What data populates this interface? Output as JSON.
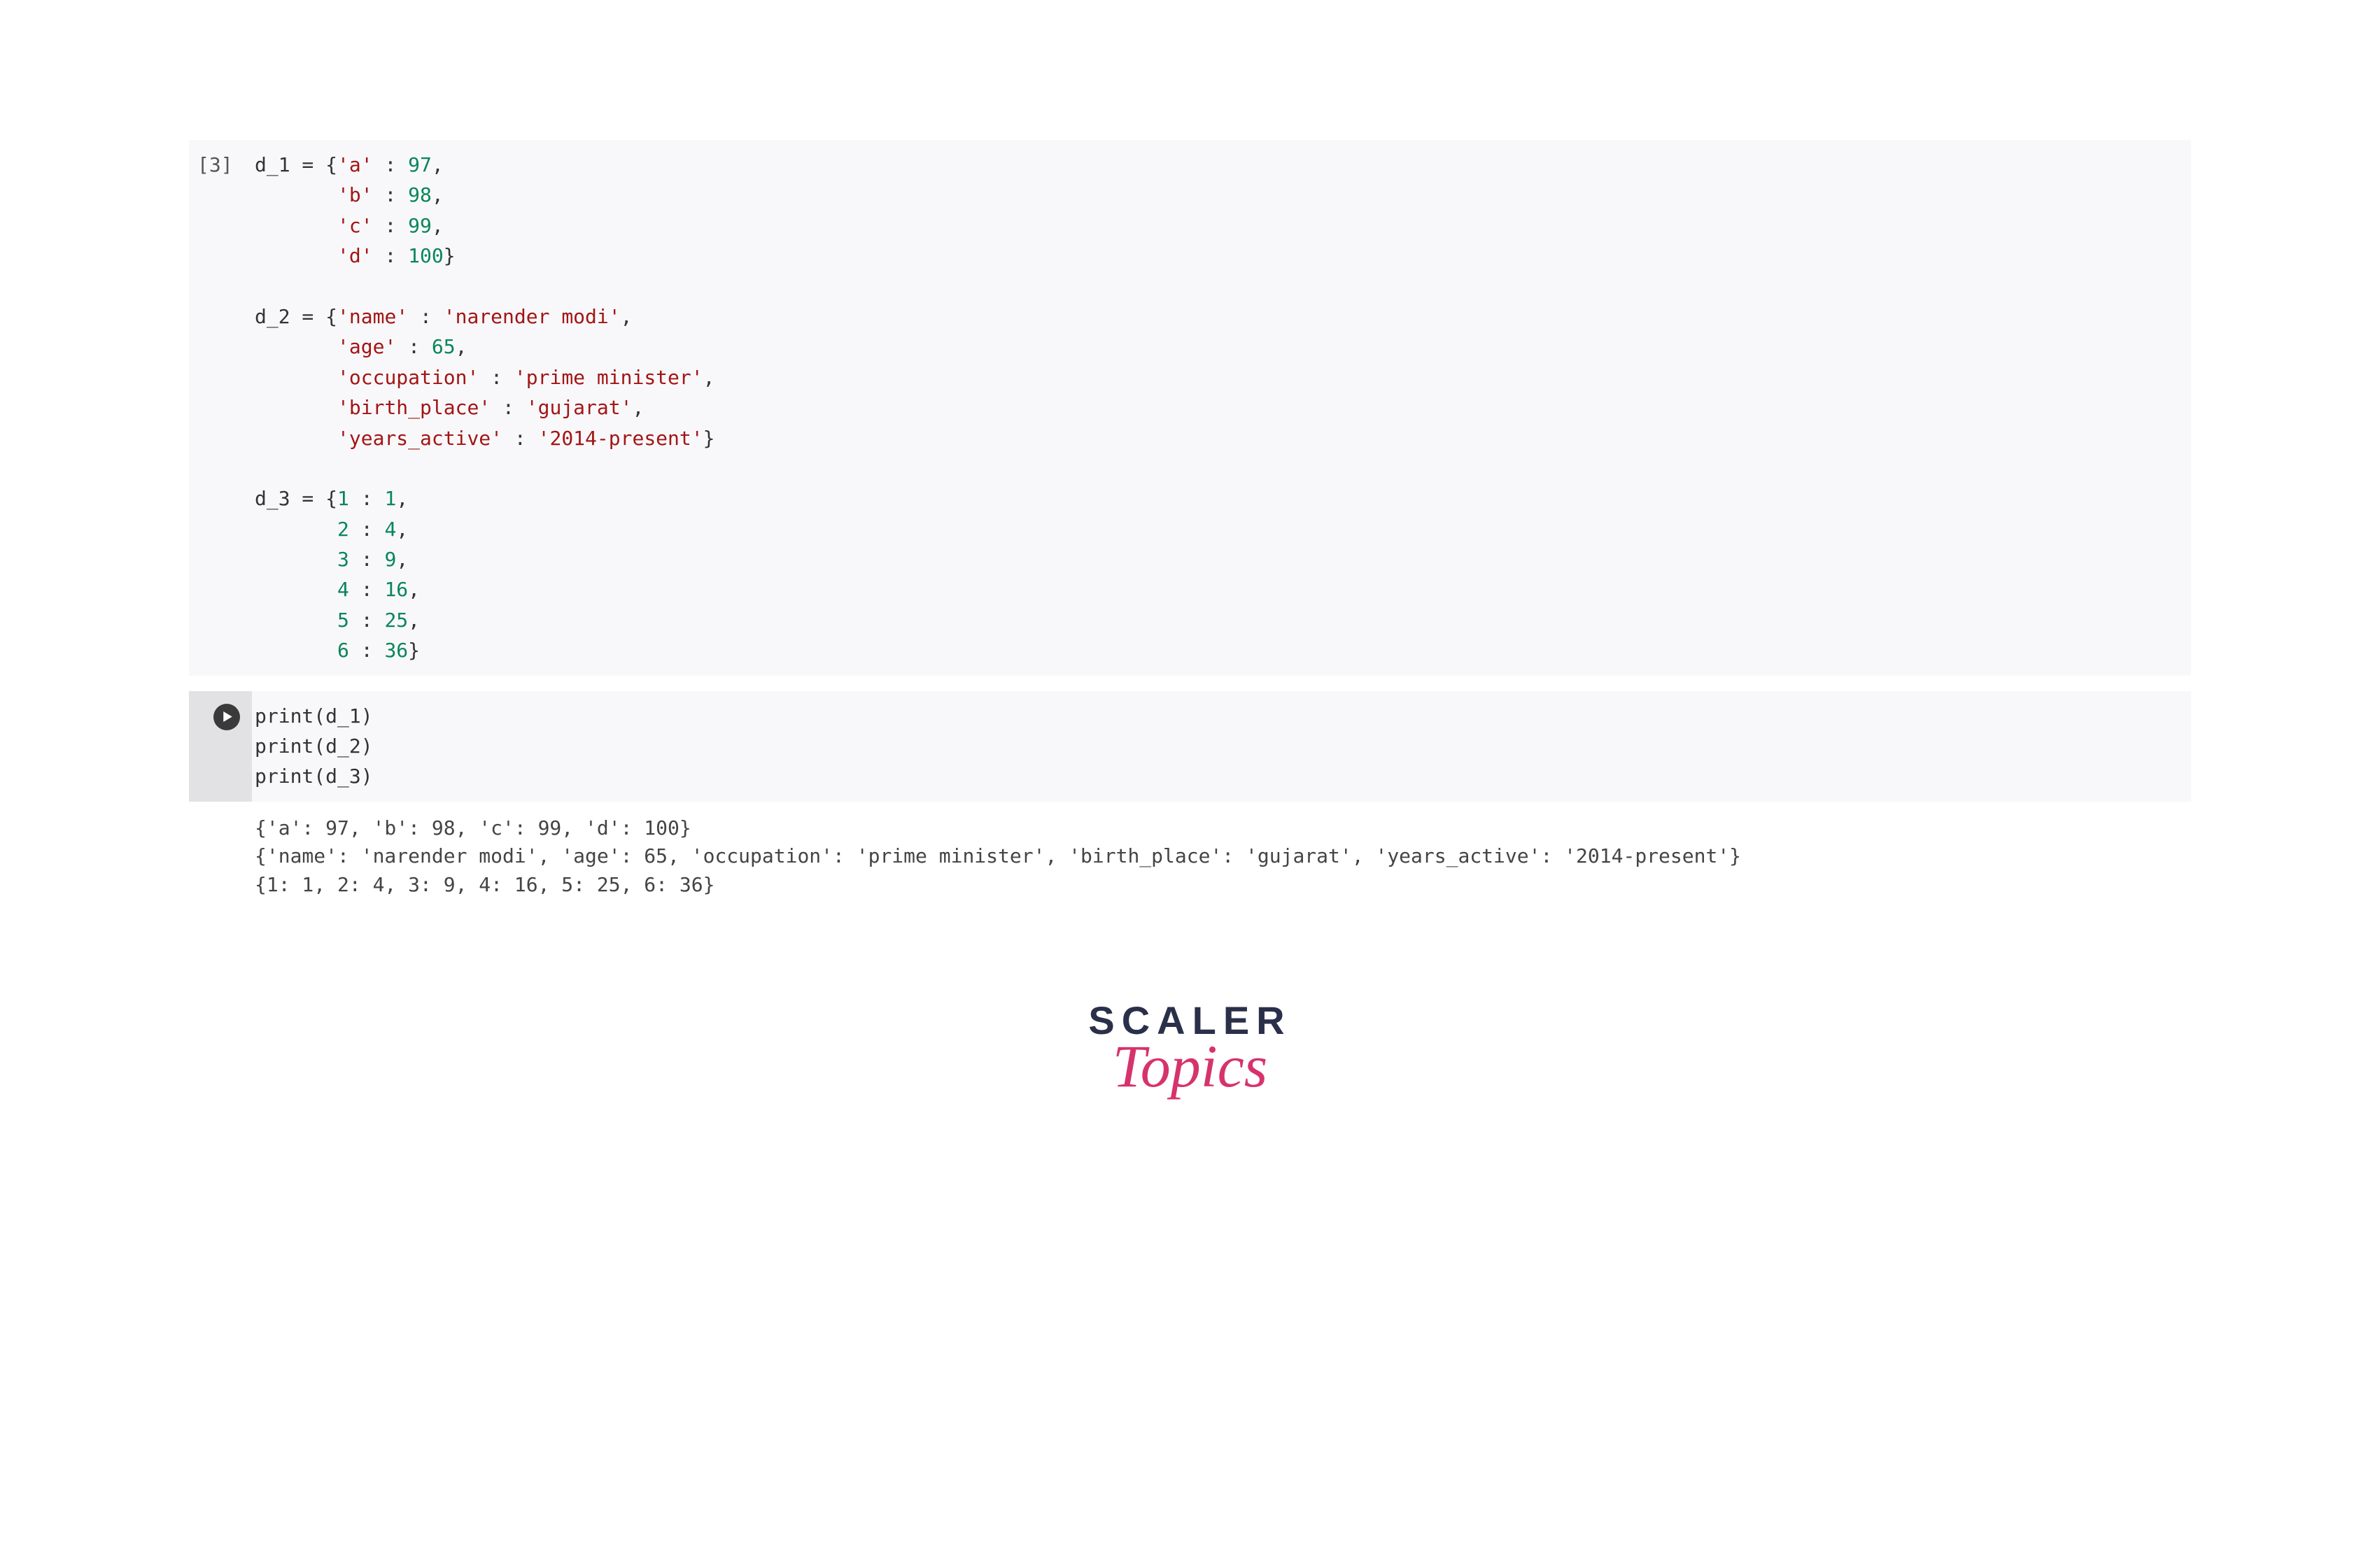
{
  "cell1": {
    "execution_count": "[3]",
    "code_tokens": [
      [
        [
          "id",
          "d_1"
        ],
        [
          "op",
          " = {"
        ],
        [
          "str",
          "'a'"
        ],
        [
          "op",
          " : "
        ],
        [
          "num",
          "97"
        ],
        [
          "op",
          ","
        ]
      ],
      [
        [
          "sp",
          "       "
        ],
        [
          "str",
          "'b'"
        ],
        [
          "op",
          " : "
        ],
        [
          "num",
          "98"
        ],
        [
          "op",
          ","
        ]
      ],
      [
        [
          "sp",
          "       "
        ],
        [
          "str",
          "'c'"
        ],
        [
          "op",
          " : "
        ],
        [
          "num",
          "99"
        ],
        [
          "op",
          ","
        ]
      ],
      [
        [
          "sp",
          "       "
        ],
        [
          "str",
          "'d'"
        ],
        [
          "op",
          " : "
        ],
        [
          "num",
          "100"
        ],
        [
          "op",
          "}"
        ]
      ],
      [
        [
          "sp",
          ""
        ]
      ],
      [
        [
          "id",
          "d_2"
        ],
        [
          "op",
          " = {"
        ],
        [
          "str",
          "'name'"
        ],
        [
          "op",
          " : "
        ],
        [
          "str",
          "'narender modi'"
        ],
        [
          "op",
          ","
        ]
      ],
      [
        [
          "sp",
          "       "
        ],
        [
          "str",
          "'age'"
        ],
        [
          "op",
          " : "
        ],
        [
          "num",
          "65"
        ],
        [
          "op",
          ","
        ]
      ],
      [
        [
          "sp",
          "       "
        ],
        [
          "str",
          "'occupation'"
        ],
        [
          "op",
          " : "
        ],
        [
          "str",
          "'prime minister'"
        ],
        [
          "op",
          ","
        ]
      ],
      [
        [
          "sp",
          "       "
        ],
        [
          "str",
          "'birth_place'"
        ],
        [
          "op",
          " : "
        ],
        [
          "str",
          "'gujarat'"
        ],
        [
          "op",
          ","
        ]
      ],
      [
        [
          "sp",
          "       "
        ],
        [
          "str",
          "'years_active'"
        ],
        [
          "op",
          " : "
        ],
        [
          "str",
          "'2014-present'"
        ],
        [
          "op",
          "}"
        ]
      ],
      [
        [
          "sp",
          ""
        ]
      ],
      [
        [
          "id",
          "d_3"
        ],
        [
          "op",
          " = {"
        ],
        [
          "num",
          "1"
        ],
        [
          "op",
          " : "
        ],
        [
          "num",
          "1"
        ],
        [
          "op",
          ","
        ]
      ],
      [
        [
          "sp",
          "       "
        ],
        [
          "num",
          "2"
        ],
        [
          "op",
          " : "
        ],
        [
          "num",
          "4"
        ],
        [
          "op",
          ","
        ]
      ],
      [
        [
          "sp",
          "       "
        ],
        [
          "num",
          "3"
        ],
        [
          "op",
          " : "
        ],
        [
          "num",
          "9"
        ],
        [
          "op",
          ","
        ]
      ],
      [
        [
          "sp",
          "       "
        ],
        [
          "num",
          "4"
        ],
        [
          "op",
          " : "
        ],
        [
          "num",
          "16"
        ],
        [
          "op",
          ","
        ]
      ],
      [
        [
          "sp",
          "       "
        ],
        [
          "num",
          "5"
        ],
        [
          "op",
          " : "
        ],
        [
          "num",
          "25"
        ],
        [
          "op",
          ","
        ]
      ],
      [
        [
          "sp",
          "       "
        ],
        [
          "num",
          "6"
        ],
        [
          "op",
          " : "
        ],
        [
          "num",
          "36"
        ],
        [
          "op",
          "}"
        ]
      ]
    ]
  },
  "cell2": {
    "code_tokens": [
      [
        [
          "fn",
          "print"
        ],
        [
          "op",
          "("
        ],
        [
          "id",
          "d_1"
        ],
        [
          "op",
          ")"
        ]
      ],
      [
        [
          "fn",
          "print"
        ],
        [
          "op",
          "("
        ],
        [
          "id",
          "d_2"
        ],
        [
          "op",
          ")"
        ]
      ],
      [
        [
          "fn",
          "print"
        ],
        [
          "op",
          "("
        ],
        [
          "id",
          "d_3"
        ],
        [
          "op",
          ")"
        ]
      ]
    ]
  },
  "output_lines": [
    "{'a': 97, 'b': 98, 'c': 99, 'd': 100}",
    "{'name': 'narender modi', 'age': 65, 'occupation': 'prime minister', 'birth_place': 'gujarat', 'years_active': '2014-present'}",
    "{1: 1, 2: 4, 3: 9, 4: 16, 5: 25, 6: 36}"
  ],
  "logo": {
    "line1": "SCALER",
    "line2": "Topics"
  }
}
